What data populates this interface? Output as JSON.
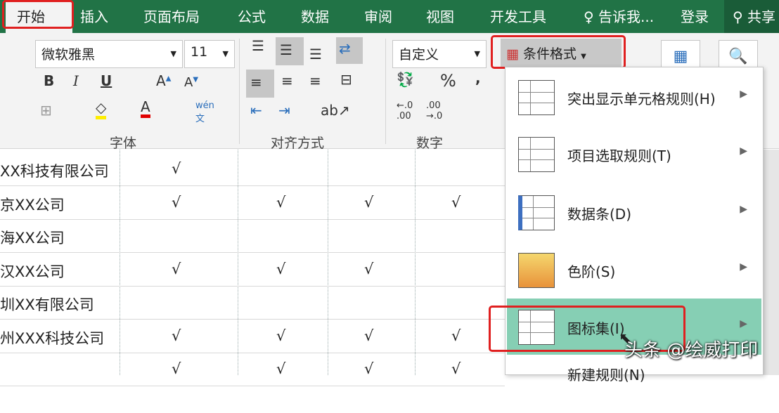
{
  "tabs": [
    "开始",
    "插入",
    "页面布局",
    "公式",
    "数据",
    "审阅",
    "视图",
    "开发工具"
  ],
  "tell_me": "告诉我...",
  "login": "登录",
  "share": "共享",
  "font": {
    "name": "微软雅黑",
    "size": "11",
    "group_label": "字体"
  },
  "alignment": {
    "group_label": "对齐方式"
  },
  "number": {
    "format": "自定义",
    "group_label": "数字",
    "percent": "%",
    "comma": ","
  },
  "conditional_format": "条件格式",
  "menu": [
    "突出显示单元格规则(H)",
    "项目选取规则(T)",
    "数据条(D)",
    "色阶(S)",
    "图标集(I)",
    "新建规则(N)"
  ],
  "rows": [
    {
      "name": "XX科技有限公司",
      "checks": [
        "√",
        "",
        "",
        ""
      ]
    },
    {
      "name": "京XX公司",
      "checks": [
        "√",
        "√",
        "√",
        "√"
      ]
    },
    {
      "name": "海XX公司",
      "checks": [
        "",
        "",
        "",
        ""
      ]
    },
    {
      "name": "汉XX公司",
      "checks": [
        "√",
        "√",
        "√",
        ""
      ]
    },
    {
      "name": "圳XX有限公司",
      "checks": [
        "",
        "",
        "",
        ""
      ]
    },
    {
      "name": "州XXX科技公司",
      "checks": [
        "√",
        "√",
        "√",
        "√"
      ]
    },
    {
      "name": "",
      "checks": [
        "√",
        "√",
        "√",
        "√"
      ]
    }
  ],
  "watermark": "头条 @绘威打印",
  "colors": {
    "excel_green": "#217346",
    "highlight": "#86cfb4",
    "annotation_red": "#e02020"
  }
}
